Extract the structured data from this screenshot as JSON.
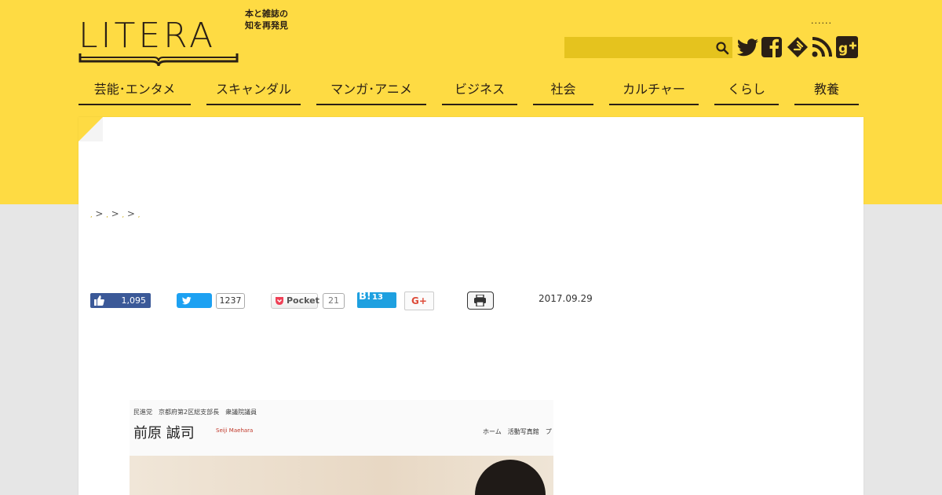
{
  "brand": {
    "logo_text": "LITERA",
    "tagline_line1": "本と雑誌の",
    "tagline_line2": "知を再発見"
  },
  "header": {
    "top_links_text": "......",
    "search_placeholder": "",
    "social_icons": [
      "twitter-icon",
      "facebook-icon",
      "feedly-icon",
      "rss-icon",
      "google-plus-icon"
    ]
  },
  "nav": {
    "items": [
      {
        "label": "芸能･エンタメ"
      },
      {
        "label": "スキャンダル"
      },
      {
        "label": "マンガ･アニメ"
      },
      {
        "label": "ビジネス"
      },
      {
        "label": "社会"
      },
      {
        "label": "カルチャー"
      },
      {
        "label": "くらし"
      },
      {
        "label": "教養"
      }
    ]
  },
  "breadcrumb": {
    "separator": ">"
  },
  "share": {
    "facebook_count": "1,095",
    "twitter_count": "1237",
    "pocket_label": "Pocket",
    "pocket_count": "21",
    "hatena_label": "B!",
    "hatena_count": "13",
    "gplus_label": "G+"
  },
  "article": {
    "date": "2017.09.29"
  },
  "embedded_image": {
    "subtitle": "民進党　京都府第2区総支部長　衆議院議員",
    "name": "前原 誠司",
    "name_en": "Seiji Maehara",
    "nav_text": "ホーム　活動写真館　プ"
  },
  "colors": {
    "brand_yellow": "#fedb43",
    "search_bg": "#e5c31e",
    "text_dark": "#2b2015",
    "facebook": "#3b5998",
    "twitter": "#1da1f2",
    "hatena": "#1ea0e0"
  }
}
